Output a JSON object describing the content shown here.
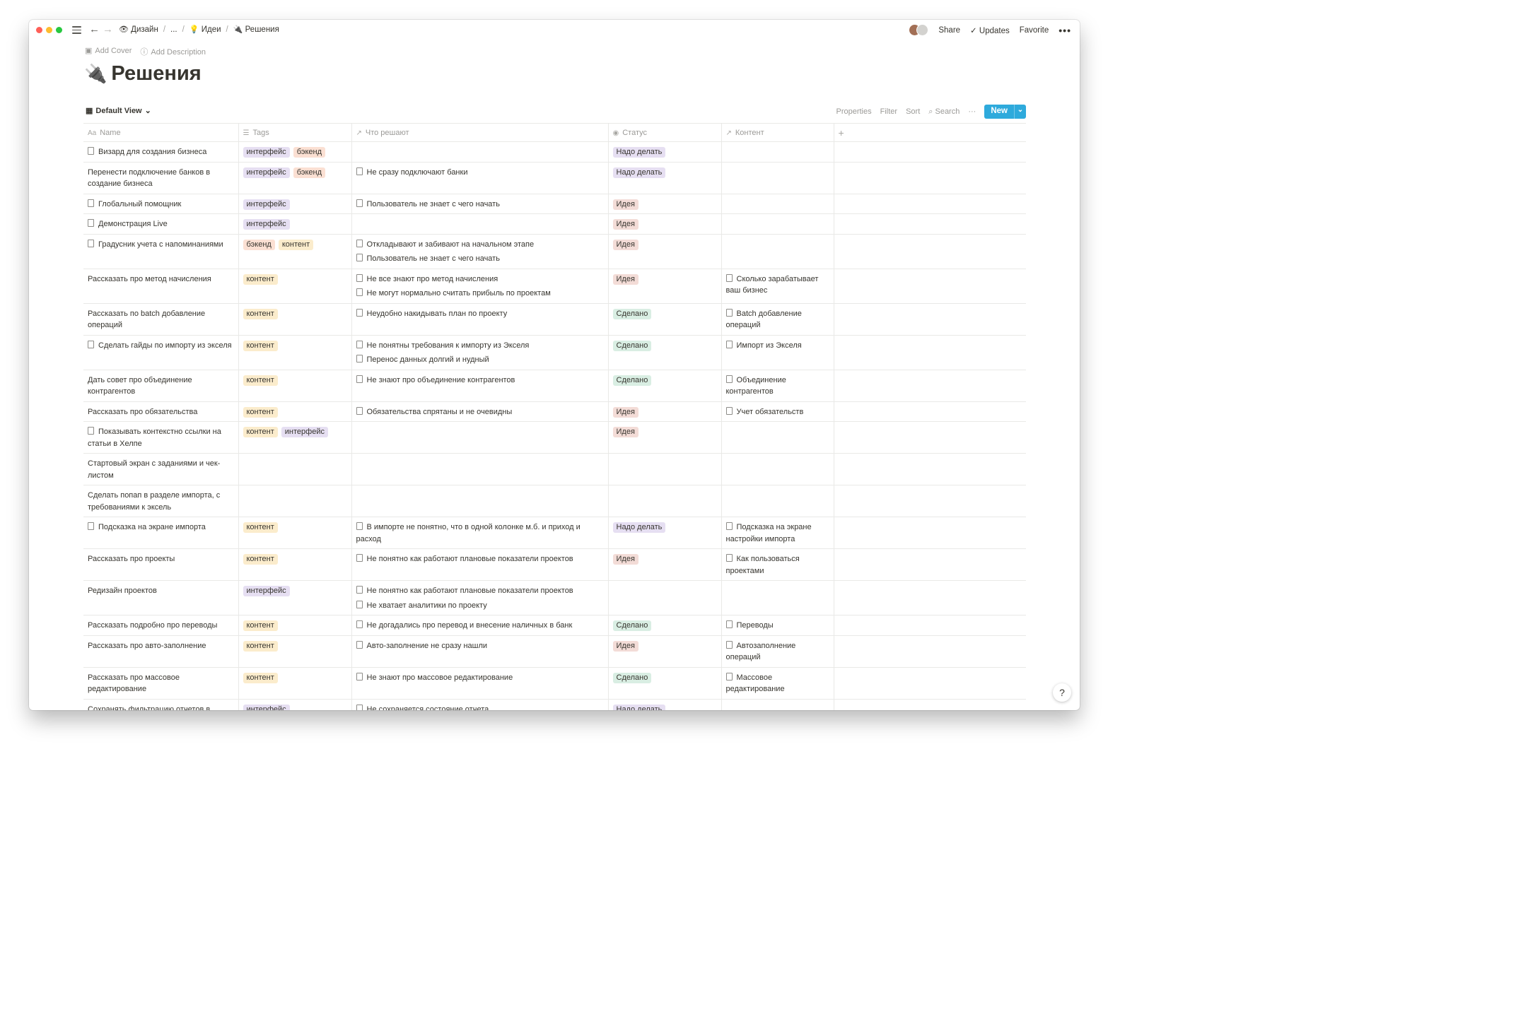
{
  "topbar": {
    "breadcrumbs": [
      {
        "icon": "👁",
        "label": "Дизайн"
      },
      {
        "icon": "",
        "label": "..."
      },
      {
        "icon": "💡",
        "label": "Идеи"
      },
      {
        "icon": "🔌",
        "label": "Решения"
      }
    ],
    "share_label": "Share",
    "updates_label": "Updates",
    "favorite_label": "Favorite",
    "more_label": "•••"
  },
  "page": {
    "add_cover_label": "Add Cover",
    "add_description_label": "Add Description",
    "title_icon": "🔌",
    "title": "Решения"
  },
  "view": {
    "name": "Default View",
    "tools": [
      "Properties",
      "Filter",
      "Sort",
      "Search"
    ],
    "more_label": "···",
    "new_label": "New"
  },
  "colors": {
    "интерфейс": "#e6dff2",
    "бэкенд": "#fbe0d3",
    "контент": "#fbeccc",
    "Надо делать": "#e6dff2",
    "Идея": "#f3dcd7",
    "Сделано": "#d9eee3",
    "accent": "#2eaadc"
  },
  "columns": [
    {
      "label": "Name",
      "icon": "Aa"
    },
    {
      "label": "Tags",
      "icon": "☰"
    },
    {
      "label": "Что решают",
      "icon": "↗"
    },
    {
      "label": "Статус",
      "icon": "◉"
    },
    {
      "label": "Контент",
      "icon": "↗"
    }
  ],
  "rows": [
    {
      "name": "Визард для создания бизнеса",
      "doc": true,
      "tags": [
        "интерфейс",
        "бэкенд"
      ],
      "solves": [],
      "status": "Надо делать",
      "content": []
    },
    {
      "name": "Перенести подключение банков в создание бизнеса",
      "doc": false,
      "tags": [
        "интерфейс",
        "бэкенд"
      ],
      "solves": [
        "Не сразу подключают банки"
      ],
      "status": "Надо делать",
      "content": []
    },
    {
      "name": "Глобальный помощник",
      "doc": true,
      "tags": [
        "интерфейс"
      ],
      "solves": [
        "Пользователь не знает с чего начать"
      ],
      "status": "Идея",
      "content": []
    },
    {
      "name": "Демонстрация Live",
      "doc": true,
      "tags": [
        "интерфейс"
      ],
      "solves": [],
      "status": "Идея",
      "content": []
    },
    {
      "name": "Градусник учета с напоминаниями",
      "doc": true,
      "tags": [
        "бэкенд",
        "контент"
      ],
      "solves": [
        "Откладывают и забивают на начальном этапе",
        "Пользователь не знает с чего начать"
      ],
      "status": "Идея",
      "content": []
    },
    {
      "name": "Рассказать про метод начисления",
      "doc": false,
      "tags": [
        "контент"
      ],
      "solves": [
        "Не все знают про метод начисления",
        "Не могут нормально считать прибыль по проектам"
      ],
      "status": "Идея",
      "content": [
        "Сколько зарабатывает ваш бизнес"
      ]
    },
    {
      "name": "Рассказать по batch добавление операций",
      "doc": false,
      "tags": [
        "контент"
      ],
      "solves": [
        "Неудобно накидывать план по проекту"
      ],
      "status": "Сделано",
      "content": [
        "Batch добавление операций"
      ]
    },
    {
      "name": "Сделать гайды по импорту из экселя",
      "doc": true,
      "tags": [
        "контент"
      ],
      "solves": [
        "Не понятны требования к импорту из Экселя",
        "Перенос данных долгий и нудный"
      ],
      "status": "Сделано",
      "content": [
        "Импорт из Экселя"
      ]
    },
    {
      "name": "Дать совет про объединение контрагентов",
      "doc": false,
      "tags": [
        "контент"
      ],
      "solves": [
        "Не знают про объединение контрагентов"
      ],
      "status": "Сделано",
      "content": [
        "Объединение контрагентов"
      ]
    },
    {
      "name": "Рассказать про обязательства",
      "doc": false,
      "tags": [
        "контент"
      ],
      "solves": [
        "Обязательства спрятаны и не очевидны"
      ],
      "status": "Идея",
      "content": [
        "Учет обязательств"
      ]
    },
    {
      "name": "Показывать контекстно ссылки на статьи в Хелпе",
      "doc": true,
      "tags": [
        "контент",
        "интерфейс"
      ],
      "solves": [],
      "status": "Идея",
      "content": []
    },
    {
      "name": "Стартовый экран с заданиями и чек-листом",
      "doc": false,
      "tags": [],
      "solves": [],
      "status": "",
      "content": []
    },
    {
      "name": "Сделать попап в разделе импорта, с требованиями к эксель",
      "doc": false,
      "tags": [],
      "solves": [],
      "status": "",
      "content": []
    },
    {
      "name": "Подсказка на экране импорта",
      "doc": true,
      "tags": [
        "контент"
      ],
      "solves": [
        "В импорте не понятно, что в одной колонке м.б. и приход и расход"
      ],
      "status": "Надо делать",
      "content": [
        "Подсказка на экране настройки импорта"
      ]
    },
    {
      "name": "Рассказать про проекты",
      "doc": false,
      "tags": [
        "контент"
      ],
      "solves": [
        "Не понятно как работают плановые показатели проектов"
      ],
      "status": "Идея",
      "content": [
        "Как пользоваться проектами"
      ]
    },
    {
      "name": "Редизайн проектов",
      "doc": false,
      "tags": [
        "интерфейс"
      ],
      "solves": [
        "Не понятно как работают плановые показатели проектов",
        "Не хватает аналитики по проекту"
      ],
      "status": "",
      "content": []
    },
    {
      "name": "Рассказать подробно про переводы",
      "doc": false,
      "tags": [
        "контент"
      ],
      "solves": [
        "Не догадались про перевод и внесение наличных в банк"
      ],
      "status": "Сделано",
      "content": [
        "Переводы"
      ]
    },
    {
      "name": "Рассказать про авто-заполнение",
      "doc": false,
      "tags": [
        "контент"
      ],
      "solves": [
        "Авто-заполнение не сразу нашли"
      ],
      "status": "Идея",
      "content": [
        "Автозаполнение операций"
      ]
    },
    {
      "name": "Рассказать про массовое редактирование",
      "doc": false,
      "tags": [
        "контент"
      ],
      "solves": [
        "Не знают про массовое редактирование"
      ],
      "status": "Сделано",
      "content": [
        "Массовое редактирование"
      ]
    },
    {
      "name": "Сохранять фильтрацию отчетов в локалсторадже",
      "doc": false,
      "tags": [
        "интерфейс"
      ],
      "solves": [
        "Не сохраняется состояние отчета"
      ],
      "status": "Надо делать",
      "content": []
    }
  ],
  "help_label": "?"
}
